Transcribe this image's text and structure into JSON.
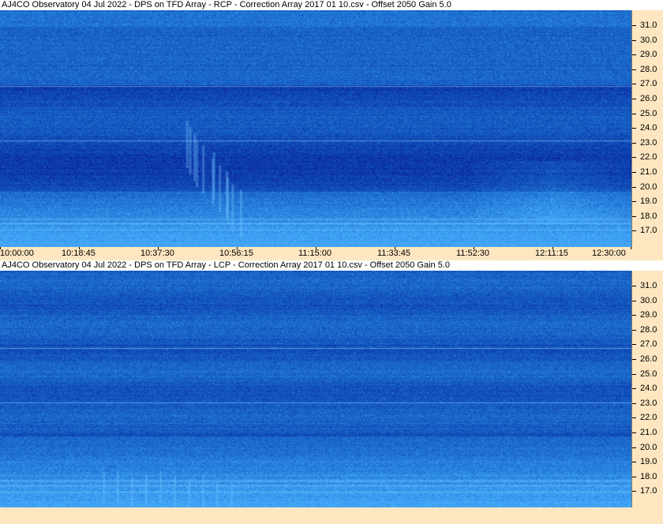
{
  "panels": [
    {
      "id": "rcp",
      "title": "AJ4CO Observatory 04  Jul 2022  -  DPS on TFD Array  -  RCP  -  Correction Array 2017 01 10.csv  -  Offset 2050  Gain 5.0",
      "freq_labels": [
        "31.0",
        "30.0",
        "29.0",
        "28.0",
        "27.0",
        "26.0",
        "25.0",
        "24.0",
        "23.0",
        "22.0",
        "21.0",
        "20.0",
        "19.0",
        "18.0",
        "17.0"
      ],
      "time_labels": [
        "10:00:00",
        "10:18:45",
        "10:37:30",
        "10:56:15",
        "11:15:00",
        "11:33:45",
        "11:52:30",
        "12:11:15",
        "12:30:00"
      ]
    },
    {
      "id": "lcp",
      "title": "AJ4CO Observatory 04  Jul 2022  -  DPS on TFD Array  -  LCP  -  Correction Array 2017 01 10.csv  -  Offset 2050  Gain 5.0",
      "freq_labels": [
        "31.0",
        "30.0",
        "29.0",
        "28.0",
        "27.0",
        "26.0",
        "25.0",
        "24.0",
        "23.0",
        "22.0",
        "21.0",
        "20.0",
        "19.0",
        "18.0",
        "17.0"
      ]
    }
  ],
  "colors": {
    "axis_background": "#fde6c0",
    "spectrogram_base": "#1a3fd6"
  }
}
